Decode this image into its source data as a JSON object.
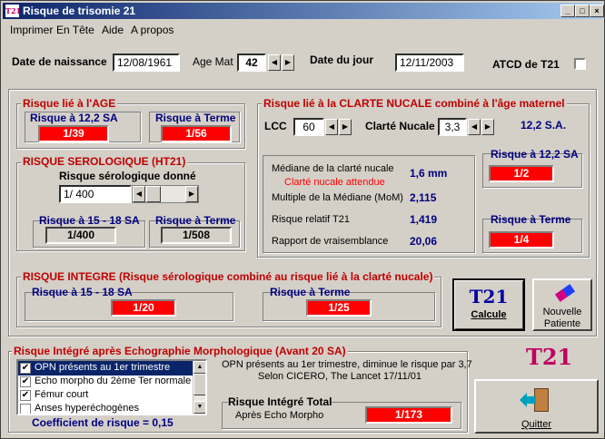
{
  "window": {
    "title": "Risque de trisomie 21",
    "icon": "T21",
    "controls": {
      "minimize": "_",
      "maximize": "□",
      "close": "×"
    }
  },
  "menu": [
    "Imprimer",
    "En Tête",
    "Aide",
    "A propos"
  ],
  "header": {
    "dob_label": "Date de naissance",
    "dob_value": "12/08/1961",
    "age_label": "Age Mat",
    "age_value": "42",
    "date_label": "Date du jour",
    "date_value": "12/11/2003",
    "atcd_label": "ATCD de T21",
    "atcd_checked": false
  },
  "age_risk": {
    "title": "Risque lié à l'AGE",
    "sa_label": "Risque à 12,2 SA",
    "sa_value": "1/39",
    "term_label": "Risque à Terme",
    "term_value": "1/56"
  },
  "serologic": {
    "title": "RISQUE SEROLOGIQUE (HT21)",
    "given_label": "Risque sérologique donné",
    "given_value": "1/ 400",
    "sa_label": "Risque à 15 - 18 SA",
    "sa_value": "1/400",
    "term_label": "Risque à Terme",
    "term_value": "1/508"
  },
  "nucal": {
    "title": "Risque lié à la CLARTE NUCALE combiné à l'âge maternel",
    "lcc_label": "LCC",
    "lcc_value": "60",
    "clarte_label": "Clarté Nucale",
    "clarte_value": "3,3",
    "sa_text": "12,2 S.A.",
    "median_label": "Médiane de la clarté nucale",
    "median_sub": "Clarté nucale attendue",
    "median_value": "1,6 mm",
    "mom_label": "Multiple de la Médiane (MoM)",
    "mom_value": "2,115",
    "rr_label": "Risque relatif T21",
    "rr_value": "1,419",
    "rv_label": "Rapport de vraisemblance",
    "rv_value": "20,06",
    "sa_risk_label": "Risque à 12,2 SA",
    "sa_risk_value": "1/2",
    "term_label": "Risque à Terme",
    "term_value": "1/4"
  },
  "integrated": {
    "title": "RISQUE INTEGRE (Risque sérologique combiné au risque lié à la clarté nucale)",
    "sa_label": "Risque à 15 - 18 SA",
    "sa_value": "1/20",
    "term_label": "Risque à Terme",
    "term_value": "1/25"
  },
  "buttons": {
    "calc_icon": "T21",
    "calc_label": "Calcule",
    "new_label_1": "Nouvelle",
    "new_label_2": "Patiente",
    "quit_label": "Quitter"
  },
  "logo": "T21",
  "echo": {
    "title": "Risque Intégré après Echographie Morphologique (Avant 20 SA)",
    "items": [
      {
        "label": "OPN présents au 1er trimestre",
        "checked": true,
        "selected": true
      },
      {
        "label": "Echo morpho du 2ème Ter normale",
        "checked": true,
        "selected": false
      },
      {
        "label": "Fémur court",
        "checked": true,
        "selected": false
      },
      {
        "label": "Anses hyperéchogènes",
        "checked": false,
        "selected": false
      }
    ],
    "coef_label": "Coefficient de risque = 0,15",
    "note_1": "OPN présents au 1er trimestre, diminue le risque par 3,7",
    "note_2": "Selon CICERO, The Lancet 17/11/01",
    "total_label": "Risque Intégré Total",
    "total_sub": "Après Echo Morpho",
    "total_value": "1/173"
  },
  "colors": {
    "accent_red": "#ff0000",
    "title_red": "#c00000",
    "navy": "#000080",
    "logo_pink": "#c00060"
  }
}
